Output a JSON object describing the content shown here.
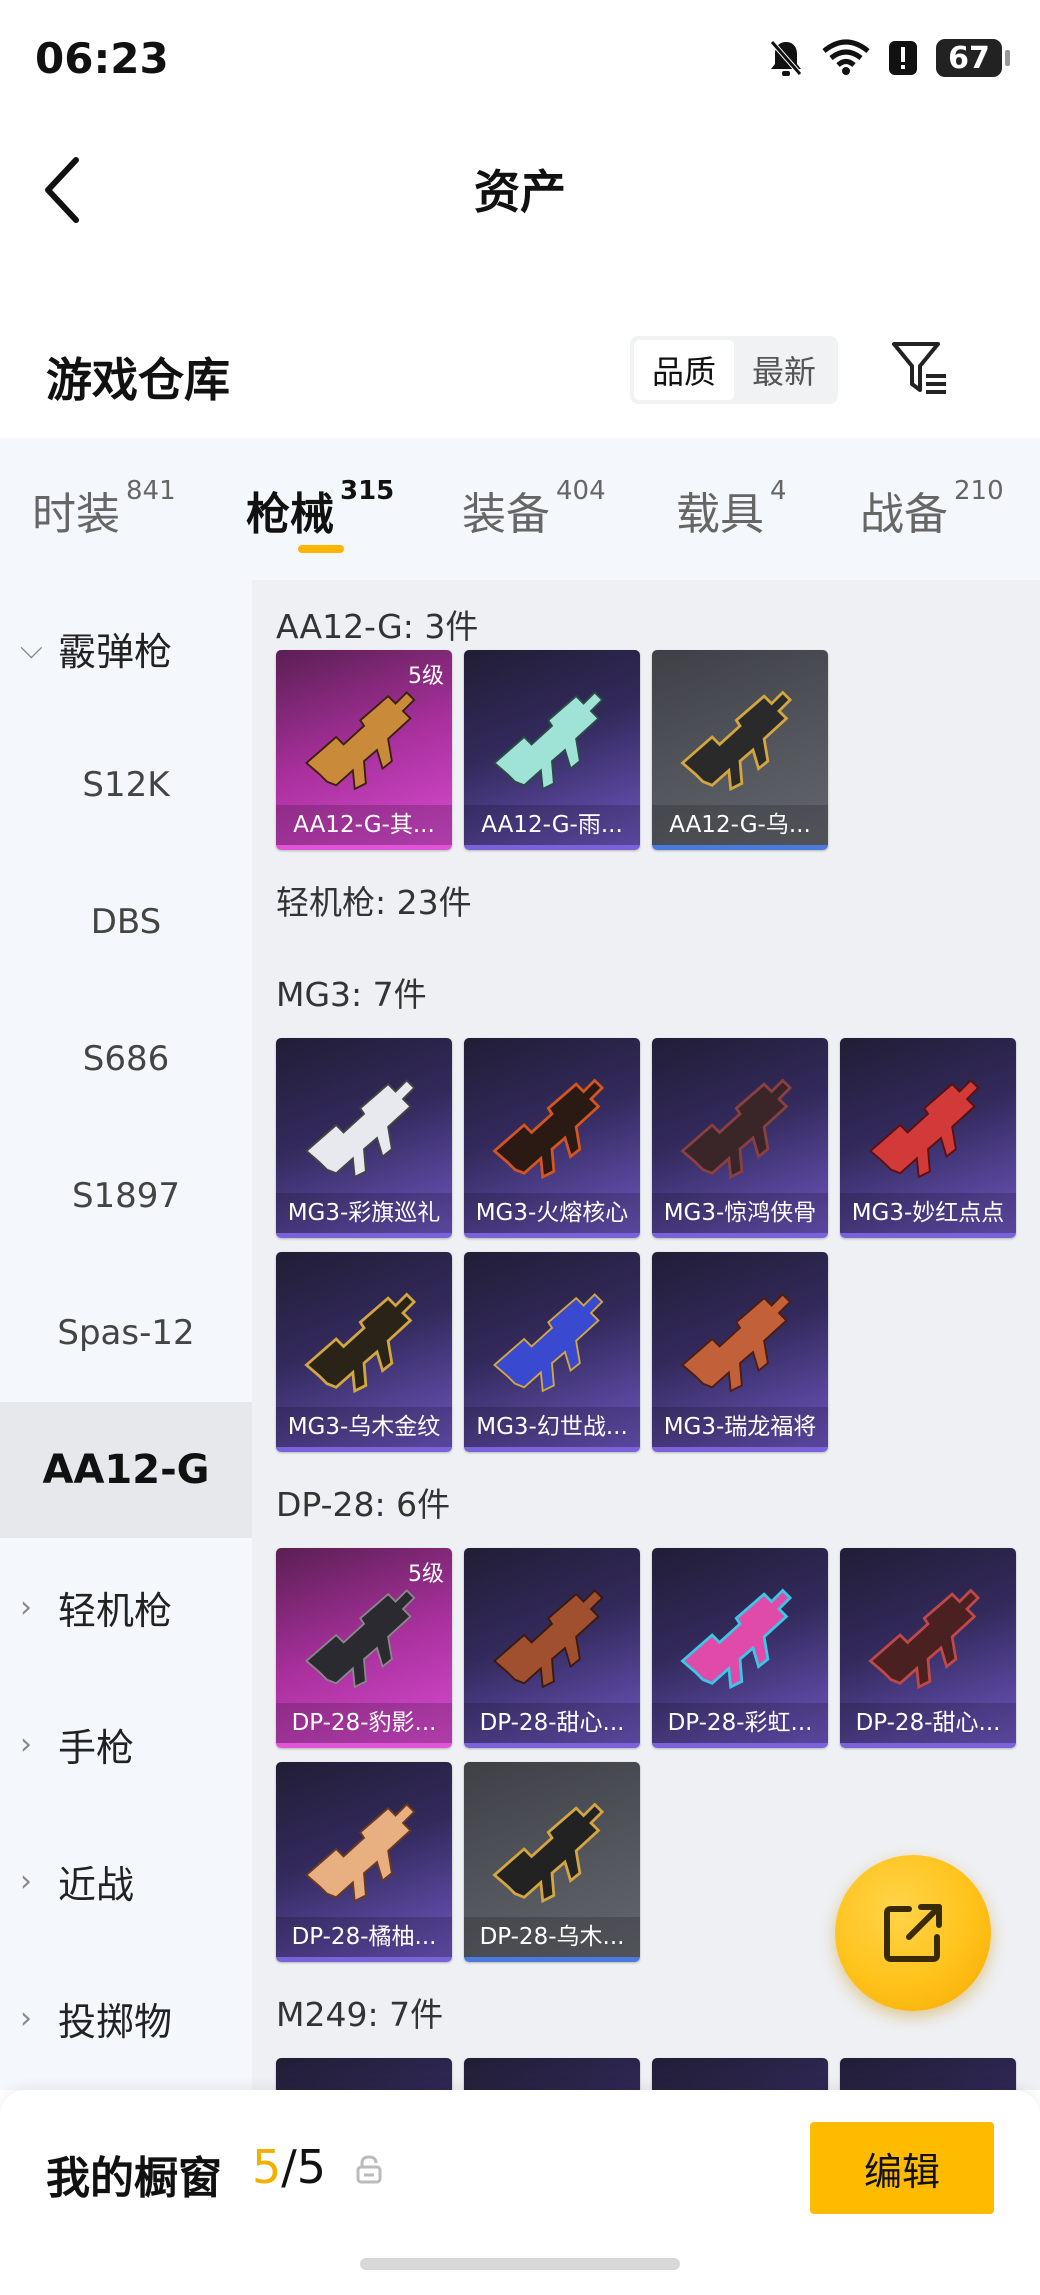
{
  "status_bar": {
    "time": "06:23",
    "battery": "67"
  },
  "header": {
    "title": "资产"
  },
  "warehouse": {
    "title": "游戏仓库",
    "sort_options": [
      "品质",
      "最新"
    ],
    "active_sort": "品质"
  },
  "tabs": [
    {
      "label": "时装",
      "count": "841"
    },
    {
      "label": "枪械",
      "count": "315"
    },
    {
      "label": "装备",
      "count": "404"
    },
    {
      "label": "载具",
      "count": "4"
    },
    {
      "label": "战备",
      "count": "210"
    }
  ],
  "active_tab": "枪械",
  "sidebar": {
    "items": [
      {
        "label": "霰弹枪",
        "kind": "category",
        "chevron": "chevron-down"
      },
      {
        "label": "S12K",
        "kind": "sub"
      },
      {
        "label": "DBS",
        "kind": "sub"
      },
      {
        "label": "S686",
        "kind": "sub"
      },
      {
        "label": "S1897",
        "kind": "sub"
      },
      {
        "label": "Spas-12",
        "kind": "sub"
      },
      {
        "label": "AA12-G",
        "kind": "sub",
        "selected": true
      },
      {
        "label": "轻机枪",
        "kind": "category",
        "chevron": "chevron-right"
      },
      {
        "label": "手枪",
        "kind": "category",
        "chevron": "chevron-right"
      },
      {
        "label": "近战",
        "kind": "category",
        "chevron": "chevron-right"
      },
      {
        "label": "投掷物",
        "kind": "category",
        "chevron": "chevron-right"
      }
    ]
  },
  "groups": [
    {
      "label": "AA12-G: 3件",
      "cards": [
        {
          "name": "AA12-G-其...",
          "rarity": "pink",
          "tier": "5级"
        },
        {
          "name": "AA12-G-雨...",
          "rarity": "purple"
        },
        {
          "name": "AA12-G-乌...",
          "rarity": "gray"
        }
      ]
    },
    {
      "label": "轻机枪: 23件",
      "cards": []
    },
    {
      "label": "MG3: 7件",
      "cards": [
        {
          "name": "MG3-彩旗巡礼",
          "rarity": "purple"
        },
        {
          "name": "MG3-火熔核心",
          "rarity": "purple"
        },
        {
          "name": "MG3-惊鸿侠骨",
          "rarity": "purple"
        },
        {
          "name": "MG3-妙红点点",
          "rarity": "purple"
        },
        {
          "name": "MG3-乌木金纹",
          "rarity": "purple"
        },
        {
          "name": "MG3-幻世战...",
          "rarity": "purple"
        },
        {
          "name": "MG3-瑞龙福将",
          "rarity": "purple"
        }
      ]
    },
    {
      "label": "DP-28: 6件",
      "cards": [
        {
          "name": "DP-28-豹影...",
          "rarity": "pink",
          "tier": "5级"
        },
        {
          "name": "DP-28-甜心...",
          "rarity": "purple"
        },
        {
          "name": "DP-28-彩虹...",
          "rarity": "purple"
        },
        {
          "name": "DP-28-甜心...",
          "rarity": "purple"
        },
        {
          "name": "DP-28-橘柚...",
          "rarity": "purple"
        },
        {
          "name": "DP-28-乌木...",
          "rarity": "gray"
        }
      ]
    },
    {
      "label": "M249: 7件",
      "cards": [
        {
          "name": "",
          "rarity": "purple"
        },
        {
          "name": "",
          "rarity": "purple"
        },
        {
          "name": "",
          "rarity": "purple"
        },
        {
          "name": "",
          "rarity": "purple"
        }
      ]
    }
  ],
  "bottom_bar": {
    "showcase_label": "我的橱窗",
    "showcase_current": "5",
    "showcase_separator": "/",
    "showcase_total": "5",
    "edit_label": "编辑"
  },
  "colors": {
    "accent": "#ffbb00",
    "rarity_purple": "#7a62d8",
    "rarity_pink": "#e055d8",
    "rarity_gray": "#4a7bdc"
  }
}
